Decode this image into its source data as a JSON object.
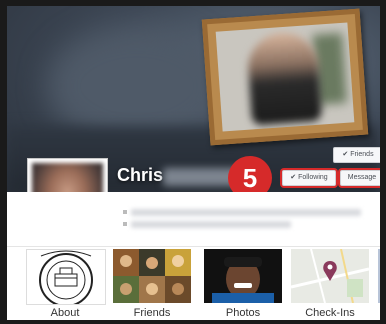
{
  "profile": {
    "name": "Chris"
  },
  "actions": {
    "friends_label": "✔ Friends",
    "following_label": "✔ Following",
    "message_label": "Message"
  },
  "annotation": {
    "step_number": "5"
  },
  "tiles": [
    {
      "label": "About",
      "icon": "seal-icon"
    },
    {
      "label": "Friends",
      "icon": "friends-collage-icon"
    },
    {
      "label": "Photos",
      "icon": "photo-icon"
    },
    {
      "label": "Check-Ins",
      "icon": "map-pin-icon"
    }
  ],
  "colors": {
    "annotation_red": "#d62a2a",
    "cover_dark": "#2b323c",
    "frame_wood": "#9a6a34"
  }
}
